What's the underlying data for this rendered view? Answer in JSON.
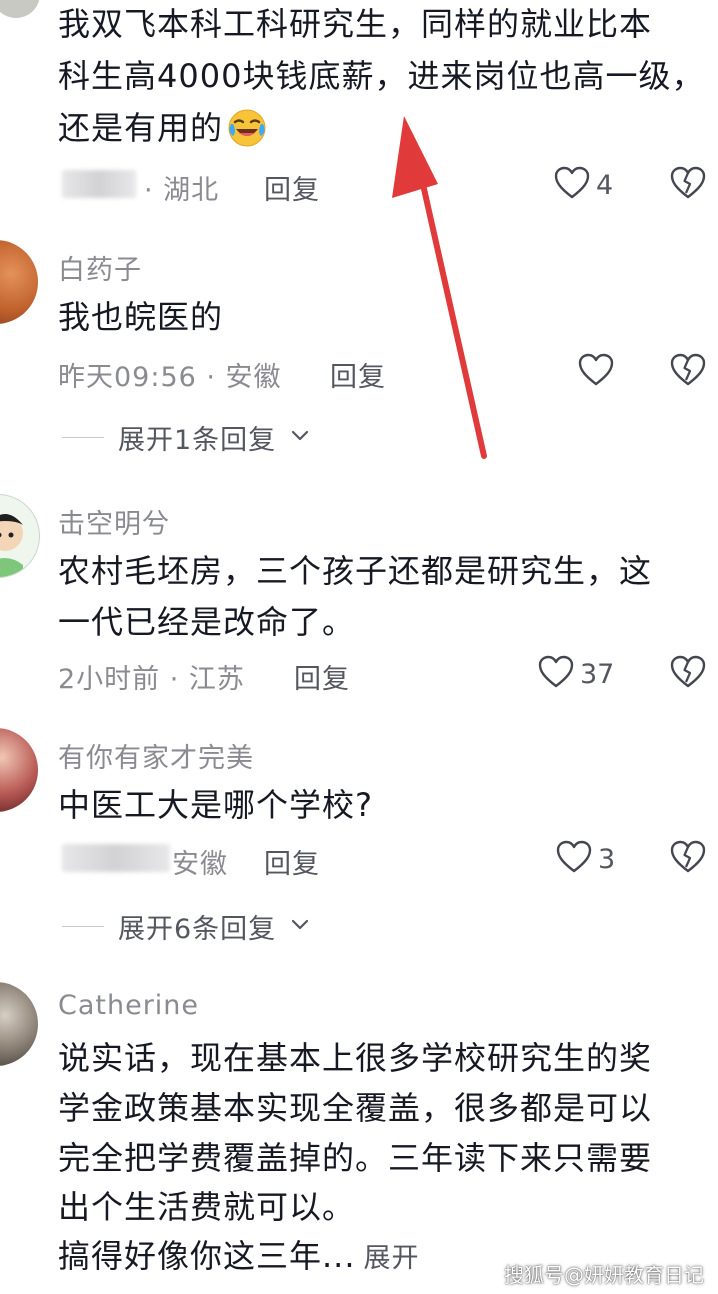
{
  "colors": {
    "background": "#ffffff",
    "text_primary": "#161823",
    "text_secondary": "#8a8b91",
    "action_text": "#555760",
    "arrow_red": "#e03a3a"
  },
  "comments": [
    {
      "text_lines": [
        "我双飞本科工科研究生，同样的就业比本",
        "科生高4000块钱底薪，进来岗位也高一级，",
        "还是有用的"
      ],
      "emoji": "laughing-crying-emoji",
      "meta": "· 湖北",
      "reply_label": "回复",
      "like_count": "4"
    },
    {
      "username": "白药子",
      "text_lines": [
        "我也皖医的"
      ],
      "meta": "昨天09:56 · 安徽",
      "reply_label": "回复",
      "like_count": "",
      "expand_label": "展开1条回复"
    },
    {
      "username": "击空明兮",
      "text_lines": [
        "农村毛坯房，三个孩子还都是研究生，这",
        "一代已经是改命了。"
      ],
      "meta": "2小时前 · 江苏",
      "reply_label": "回复",
      "like_count": "37"
    },
    {
      "username": "有你有家才完美",
      "text_lines": [
        "中医工大是哪个学校?"
      ],
      "meta": "安徽",
      "reply_label": "回复",
      "like_count": "3",
      "expand_label": "展开6条回复"
    },
    {
      "username": "Catherine",
      "text_lines": [
        "说实话，现在基本上很多学校研究生的奖",
        "学金政策基本实现全覆盖，很多都是可以",
        "完全把学费覆盖掉的。三年读下来只需要",
        "出个生活费就可以。",
        "搞得好像你这三年..."
      ],
      "more_label": "展开"
    }
  ],
  "watermark": "搜狐号@妍妍教育日记"
}
